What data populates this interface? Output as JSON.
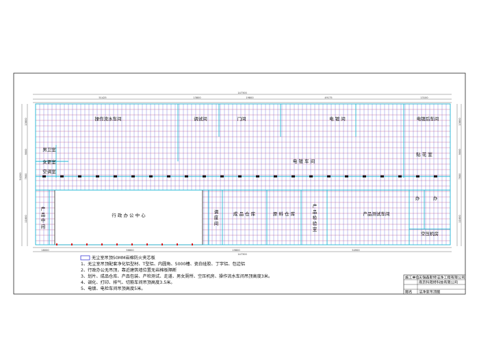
{
  "drawing": {
    "overall_width_dim": "147300",
    "overall_height_dim": "54200",
    "top_dims": [
      "51425",
      "13800",
      "19800",
      "49175",
      "13100"
    ],
    "bottom_dims": [
      "18000",
      "56800",
      "19800",
      "54900"
    ],
    "left_dims": [
      "13800",
      "9000",
      "7600",
      "11800"
    ],
    "right_dims": [
      "13800",
      "9000",
      "7600",
      "11800"
    ]
  },
  "rooms": {
    "assembly_line": "操作流水车间",
    "grind": "调试间",
    "gate": "门间",
    "electrolysis": "电 镀 间",
    "electroplate_right": "电镀后车间",
    "emboss": "贴 花 室",
    "plating": "电 镀 车 间",
    "male_wc": "男卫室",
    "changing": "女更室",
    "storage": "空调室",
    "office": "行 政 办 公 中 心",
    "product_store": "产 品 中 间",
    "dispatch": "调 度 间",
    "finished_goods": "成 品 仓 库",
    "raw_material": "原 料 仓 库",
    "product_check": "产 品 检 验 室",
    "product_test": "产品测试车间",
    "small_a": "办",
    "small_b": "办",
    "air_room": "空压机房"
  },
  "legend": {
    "item": "无尘室吊顶50MM岩棉防火夹芯板"
  },
  "notes": [
    "1、无尘室吊顶配套净化铝型材、T型铝、内圆角、5000槽、瓷白硅胶、丁字铝、包边铝",
    "2、行政办公无吊顶，靠近建筑墙位置无岩棉板隔断",
    "3、划片、成品仓库、产品包装、产检测试、走道、男女厕所、空压机房、操作流水车间吊顶高度3米。",
    "4、调化、打印、排气、切筋车间吊顶高度3.5米。",
    "5、电镀、电检车间吊顶高度5米。"
  ],
  "title_block": {
    "row1_label": "施工单位",
    "row1_value": "无锡鑫斯特洁净工程有限公司",
    "row2_label": "",
    "row2_value": "南京科陌特科技有限公司",
    "row3_label": "",
    "row3_value": "",
    "row4_label": "图名",
    "row4_value": "洁净室吊顶图"
  }
}
